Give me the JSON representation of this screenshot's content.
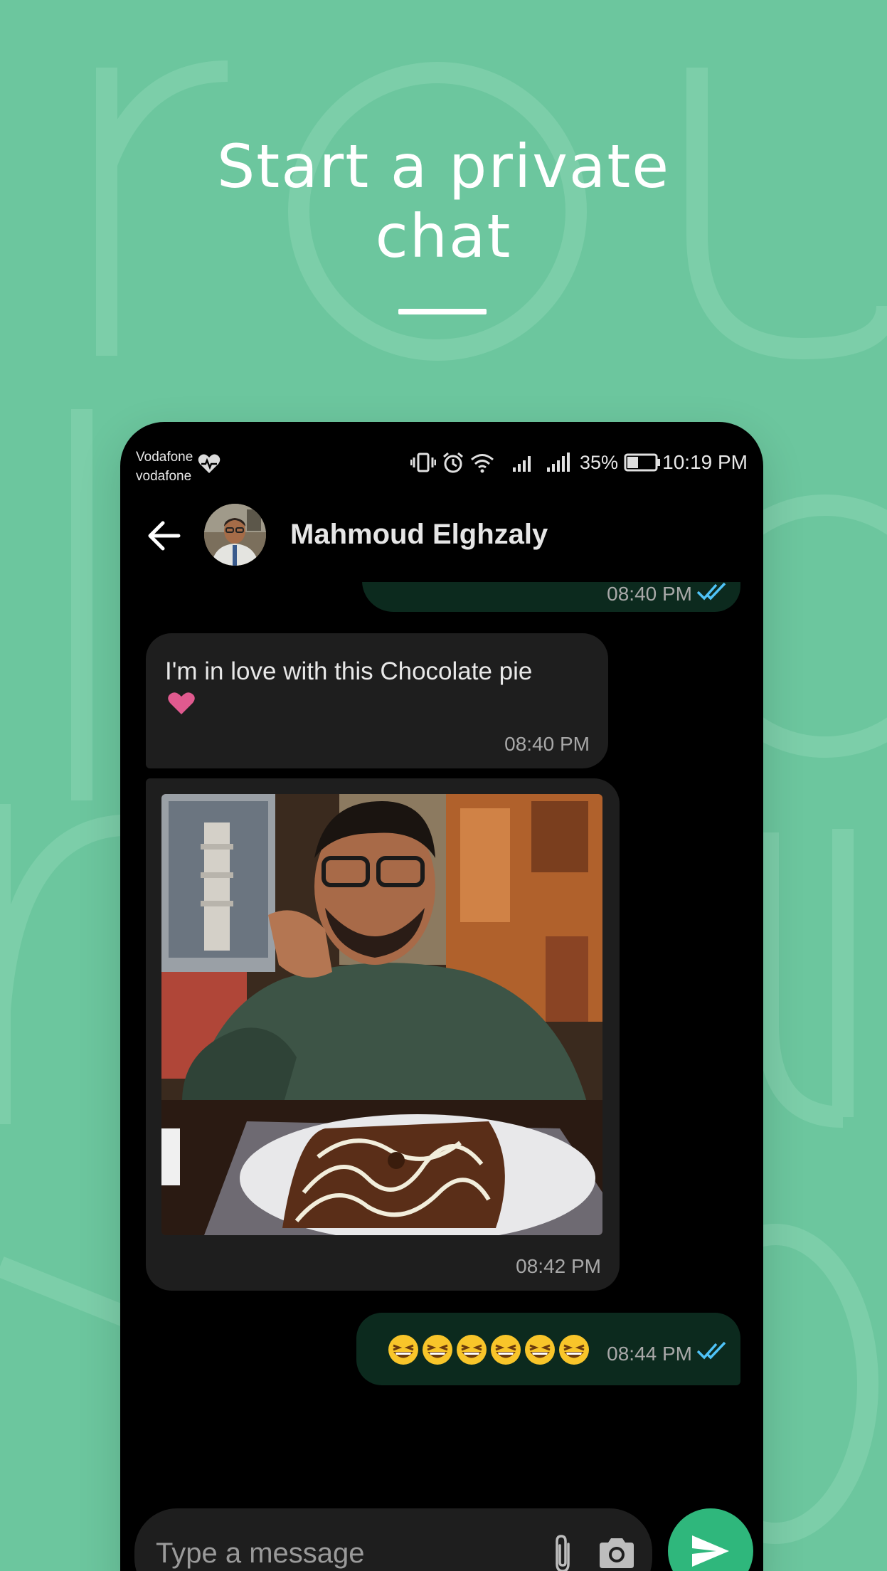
{
  "headline": {
    "line1": "Start a private",
    "line2": "chat"
  },
  "statusbar": {
    "carrier1": "Vodafone",
    "carrier2": "vodafone",
    "battery": "35%",
    "time": "10:19 PM"
  },
  "chat": {
    "contact_name": "Mahmoud Elghzaly",
    "messages": [
      {
        "direction": "outgoing",
        "time": "08:40 PM",
        "status": "read"
      },
      {
        "direction": "incoming",
        "text": "I'm in love with this Chocolate pie",
        "emoji": "heart",
        "time": "08:40 PM"
      },
      {
        "direction": "incoming",
        "type": "photo",
        "time": "08:42 PM"
      },
      {
        "direction": "outgoing",
        "emoji": "grinning-squinting-face x6",
        "time": "08:44 PM",
        "status": "read"
      }
    ]
  },
  "composer": {
    "placeholder": "Type a message"
  },
  "colors": {
    "background": "#6cc69e",
    "outgoing_bubble": "#0c2a1e",
    "incoming_bubble": "#1e1e1e",
    "accent": "#2fb77c",
    "read_tick": "#4fc3f7",
    "heart": "#e05a8f"
  }
}
